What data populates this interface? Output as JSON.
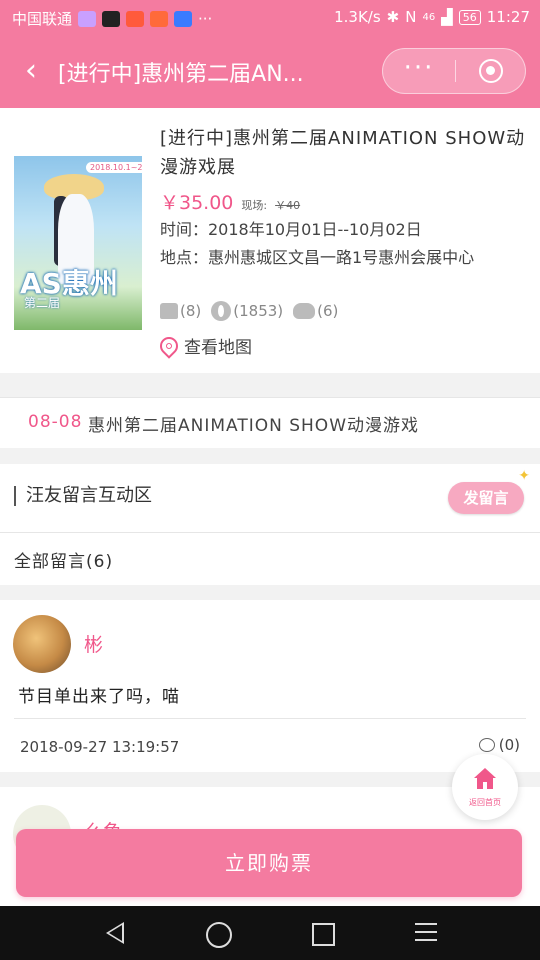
{
  "status_bar": {
    "carrier": "中国联通",
    "more": "···",
    "net_speed": "1.3K/s",
    "signal": "46",
    "battery": "56",
    "time": "11:27"
  },
  "nav": {
    "title": "[进行中]惠州第二届AN...",
    "more_icon": "···"
  },
  "event": {
    "title": "[进行中]惠州第二届ANIMATION SHOW动漫游戏展",
    "price": "￥35.00",
    "onsite_label": "现场:",
    "onsite_price": "￥40",
    "time": "时间：2018年10月01日--10月02日",
    "place": "地点：惠州惠城区文昌一路1号惠州会展中心",
    "likes": "(8)",
    "views": "(1853)",
    "cats": "(6)",
    "map_link": "查看地图",
    "poster": {
      "date": "2018.10.1~2",
      "logo": "AS惠州",
      "sub": "第二届"
    }
  },
  "news": {
    "date": "08-08",
    "text": "惠州第二届ANIMATION SHOW动漫游戏"
  },
  "comments_section": {
    "title": "汪友留言互动区",
    "post_button": "发留言",
    "all_label": "全部留言(6)"
  },
  "comments": [
    {
      "name": "彬",
      "text": "节目单出来了吗，喵",
      "time": "2018-09-27 13:19:57",
      "replies": "(0)"
    },
    {
      "name": "么鱼"
    }
  ],
  "fab": {
    "label": "返回首页"
  },
  "buy_button": "立即购票",
  "colors": {
    "brand": "#f47ba0",
    "accent": "#f0578a"
  }
}
